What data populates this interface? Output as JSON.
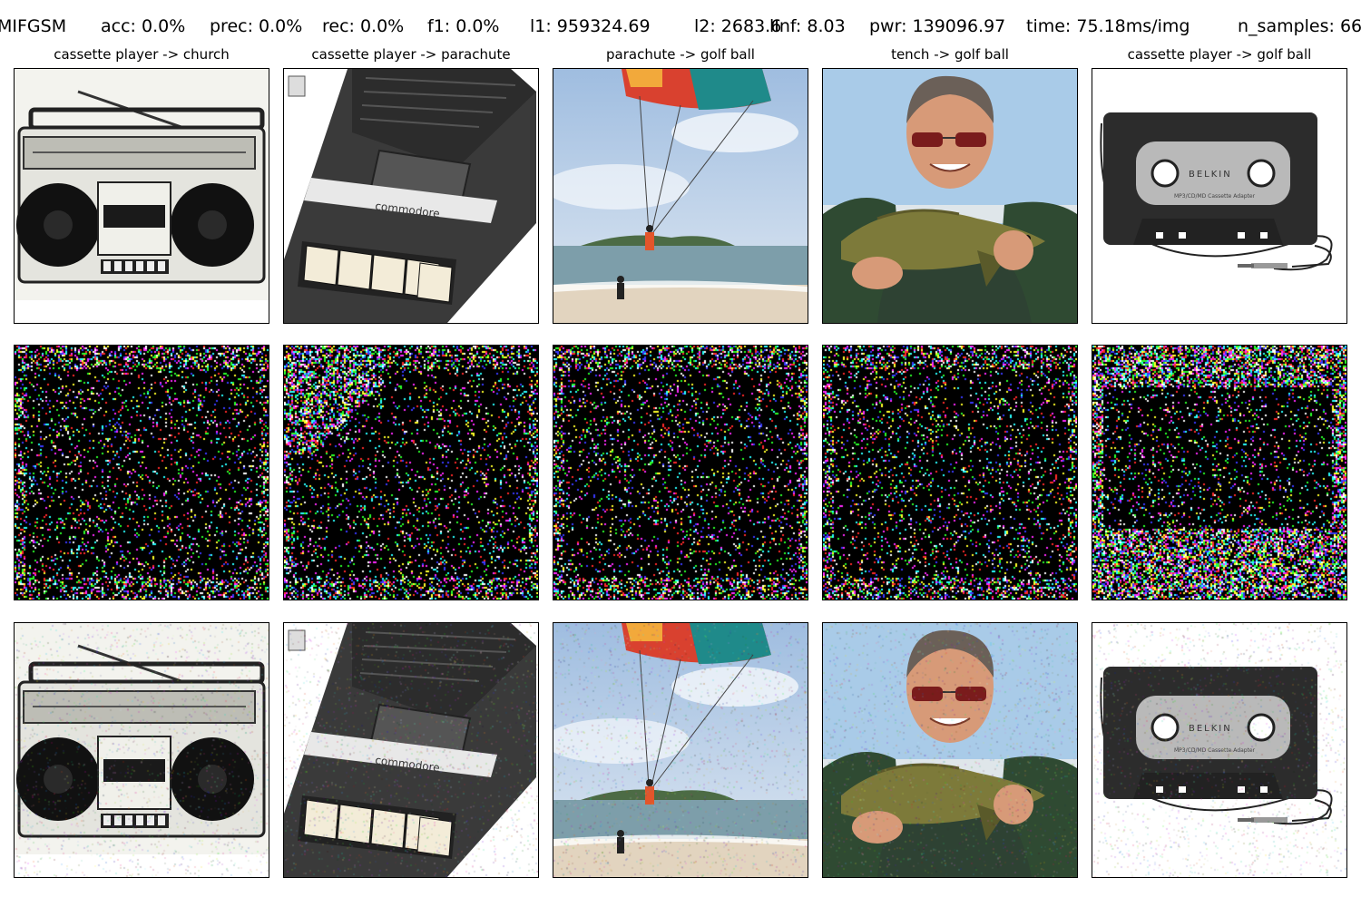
{
  "header": {
    "method": "MIFGSM",
    "acc": "acc: 0.0%",
    "prec": "prec: 0.0%",
    "rec": "rec: 0.0%",
    "f1": "f1: 0.0%",
    "l1": "l1: 959324.69",
    "l2": "l2: 2683.6",
    "linf": "lInf: 8.03",
    "pwr": "pwr: 139096.97",
    "time": "time: 75.18ms/img",
    "n_samples": "n_samples: 66"
  },
  "columns": [
    {
      "title": "cassette player -> church",
      "subject": "boombox"
    },
    {
      "title": "cassette player -> parachute",
      "subject": "commodore-tape-deck"
    },
    {
      "title": "parachute -> golf ball",
      "subject": "parasailing-beach"
    },
    {
      "title": "tench -> golf ball",
      "subject": "man-holding-fish"
    },
    {
      "title": "cassette player -> golf ball",
      "subject": "cassette-adapter"
    }
  ],
  "rows": [
    "original",
    "perturbation",
    "adversarial"
  ],
  "image_text": {
    "commodore_logo": "commodore",
    "belkin_logo": "BELKIN",
    "belkin_caption": "MP3/CD/MD Cassette Adapter"
  }
}
